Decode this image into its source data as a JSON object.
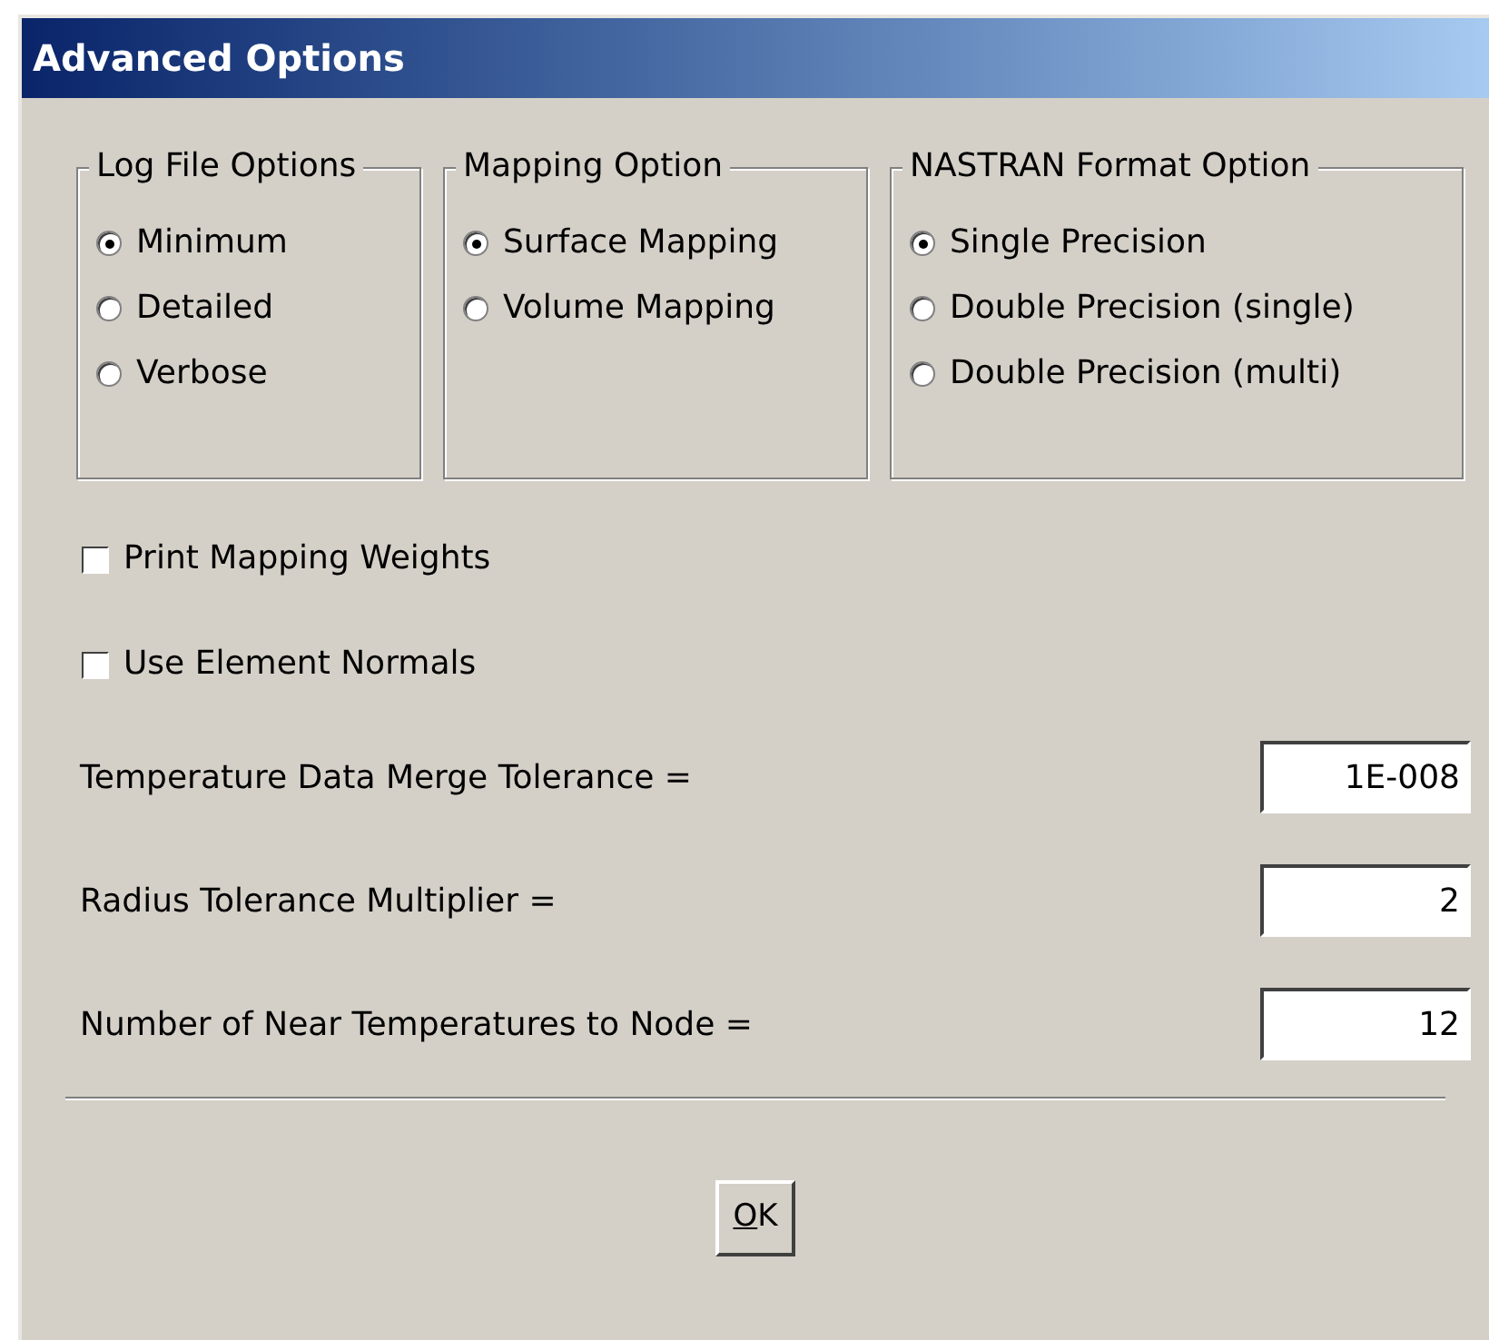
{
  "window": {
    "title": "Advanced Options"
  },
  "groups": [
    {
      "title": "Log File Options",
      "options": [
        {
          "label": "Minimum",
          "selected": true
        },
        {
          "label": "Detailed",
          "selected": false
        },
        {
          "label": "Verbose",
          "selected": false
        }
      ]
    },
    {
      "title": "Mapping Option",
      "options": [
        {
          "label": "Surface Mapping",
          "selected": true
        },
        {
          "label": "Volume Mapping",
          "selected": false
        }
      ]
    },
    {
      "title": "NASTRAN Format Option",
      "options": [
        {
          "label": "Single Precision",
          "selected": true
        },
        {
          "label": "Double Precision (single)",
          "selected": false
        },
        {
          "label": "Double Precision (multi)",
          "selected": false
        }
      ]
    }
  ],
  "checkboxes": [
    {
      "label": "Print Mapping Weights",
      "checked": false
    },
    {
      "label": "Use Element Normals",
      "checked": false
    }
  ],
  "fields": [
    {
      "label": "Temperature Data Merge Tolerance =",
      "value": "1E-008"
    },
    {
      "label": "Radius Tolerance Multiplier =",
      "value": "2"
    },
    {
      "label": "Number of Near Temperatures to Node =",
      "value": "12"
    }
  ],
  "buttons": [
    {
      "label": "OK"
    }
  ]
}
